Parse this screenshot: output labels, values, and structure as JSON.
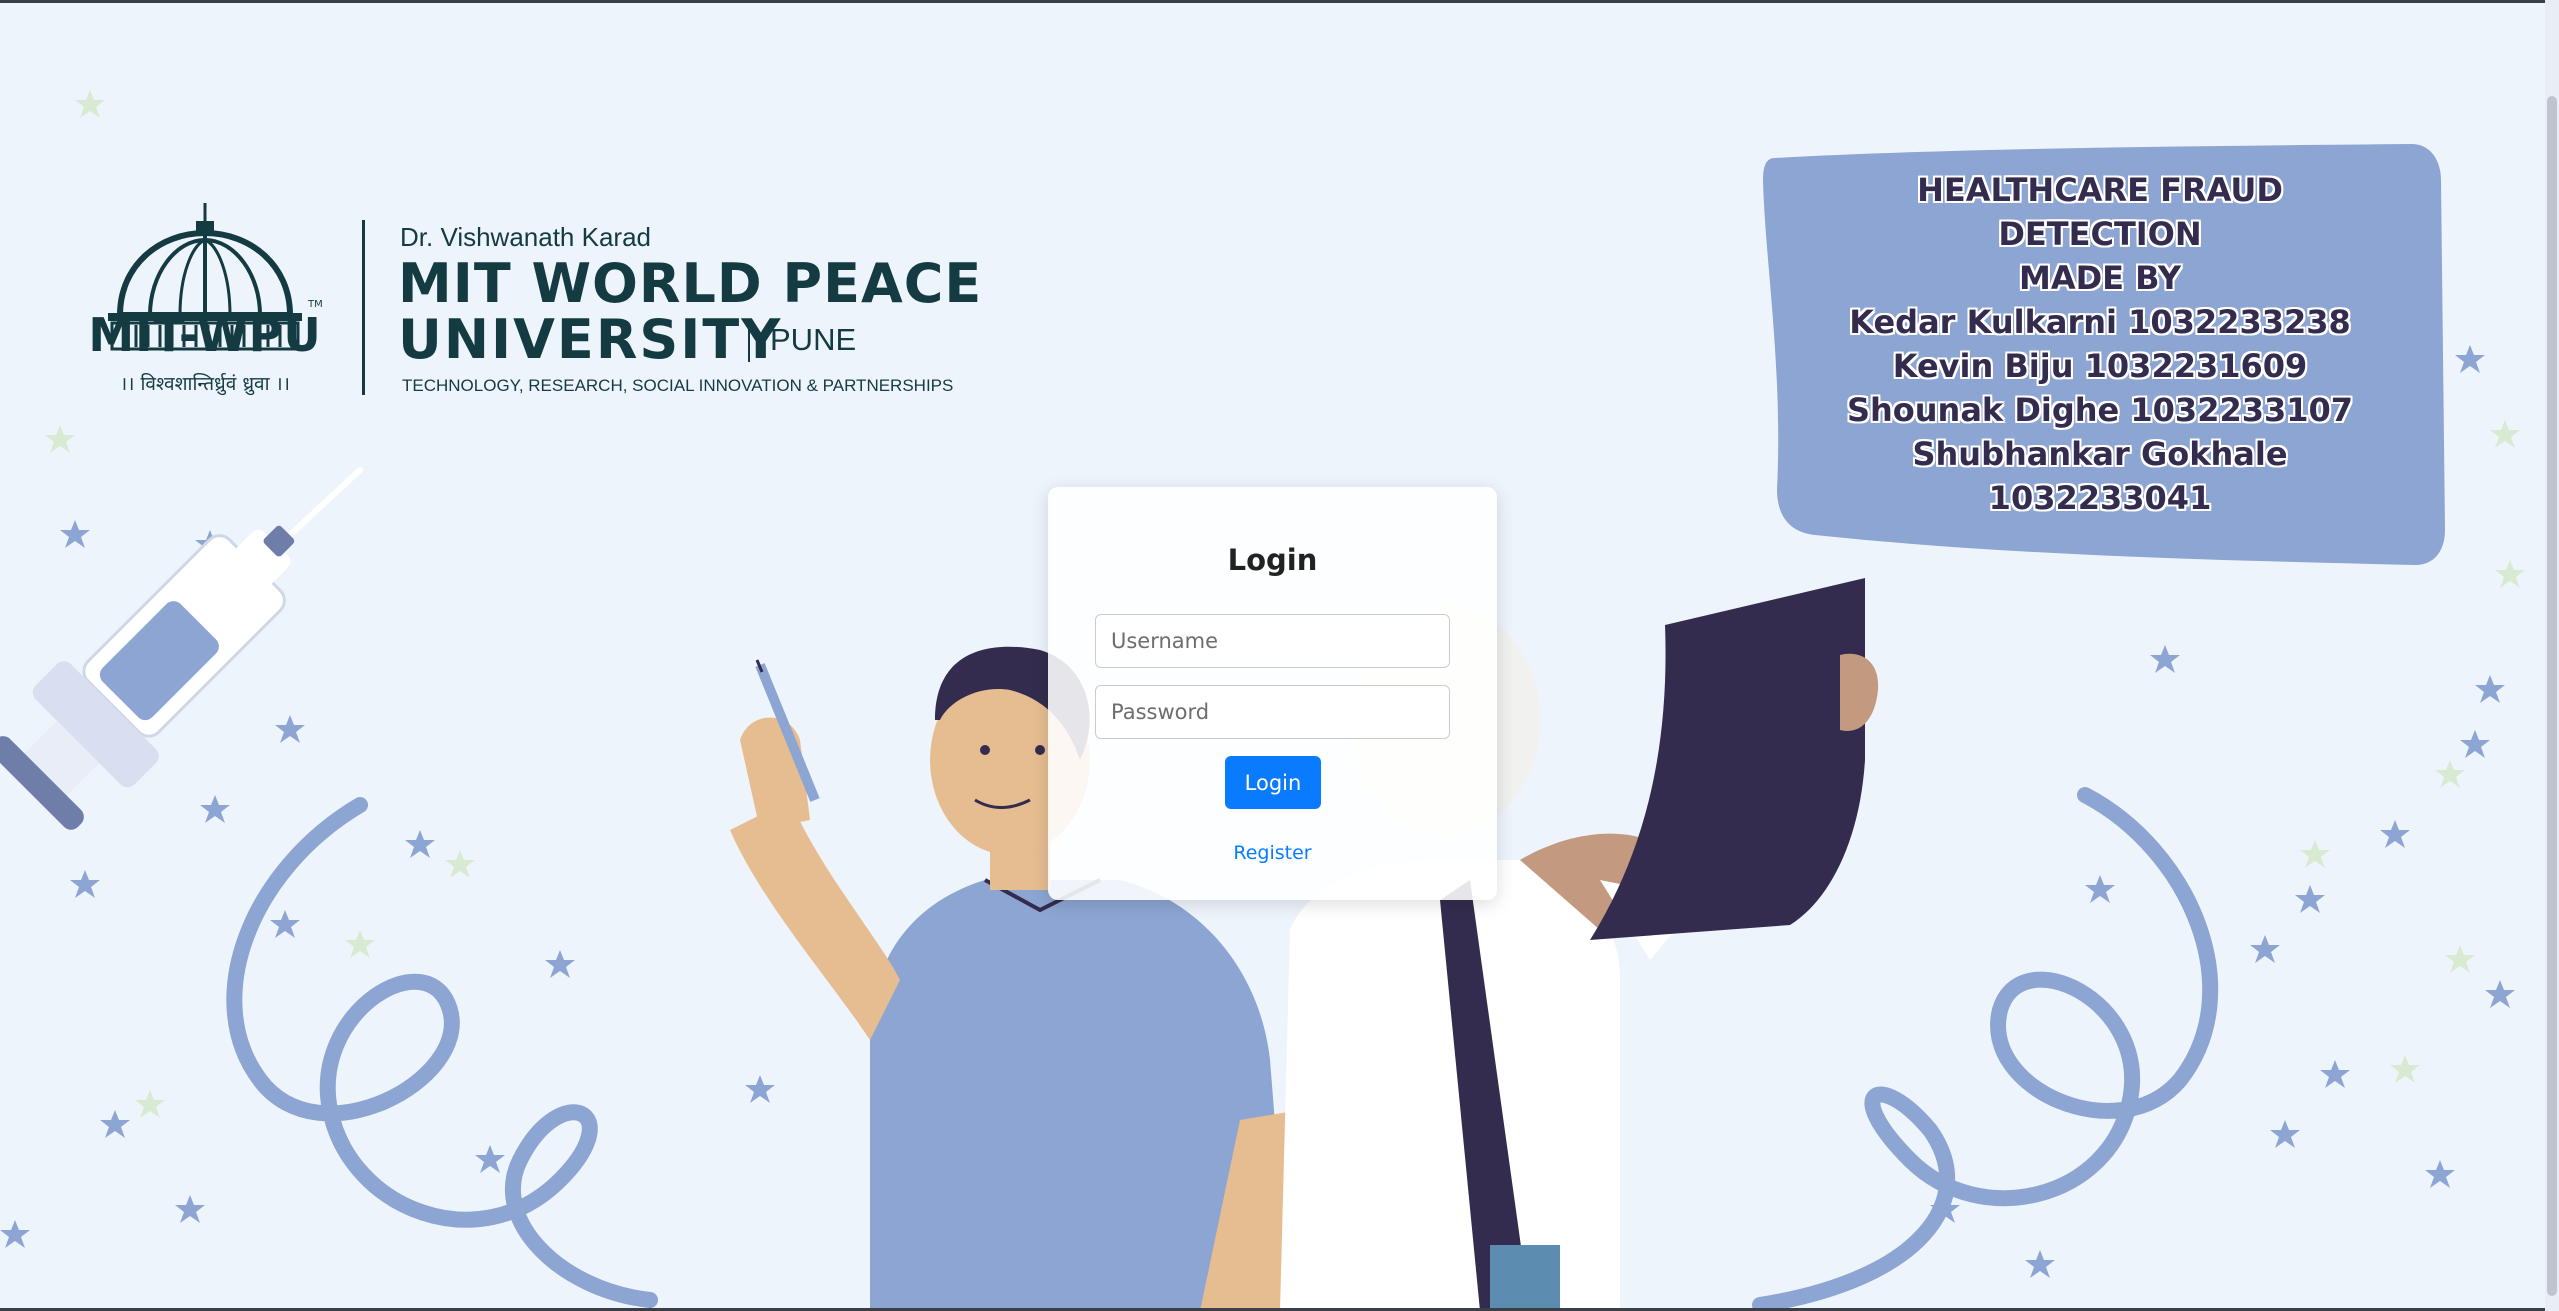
{
  "logo": {
    "brand_short": "MIT-WPU",
    "motto": "।। विश्वशान्तिर्ध्रुवं ध्रुवा ।।",
    "founder": "Dr. Vishwanath Karad",
    "university_line1": "MIT WORLD PEACE",
    "university_line2": "UNIVERSITY",
    "city": "PUNE",
    "tagline": "TECHNOLOGY, RESEARCH, SOCIAL INNOVATION & PARTNERSHIPS",
    "trademark": "TM"
  },
  "banner": {
    "lines": [
      "HEALTHCARE FRAUD",
      "DETECTION",
      "MADE BY",
      "Kedar Kulkarni 1032233238",
      "Kevin Biju 1032231609",
      "Shounak Dighe 1032233107",
      "Shubhankar Gokhale",
      "1032233041"
    ],
    "background_color": "#8ca5d2"
  },
  "login": {
    "title": "Login",
    "username_placeholder": "Username",
    "password_placeholder": "Password",
    "button_label": "Login",
    "register_label": "Register",
    "accent_color": "#0a7bff"
  }
}
